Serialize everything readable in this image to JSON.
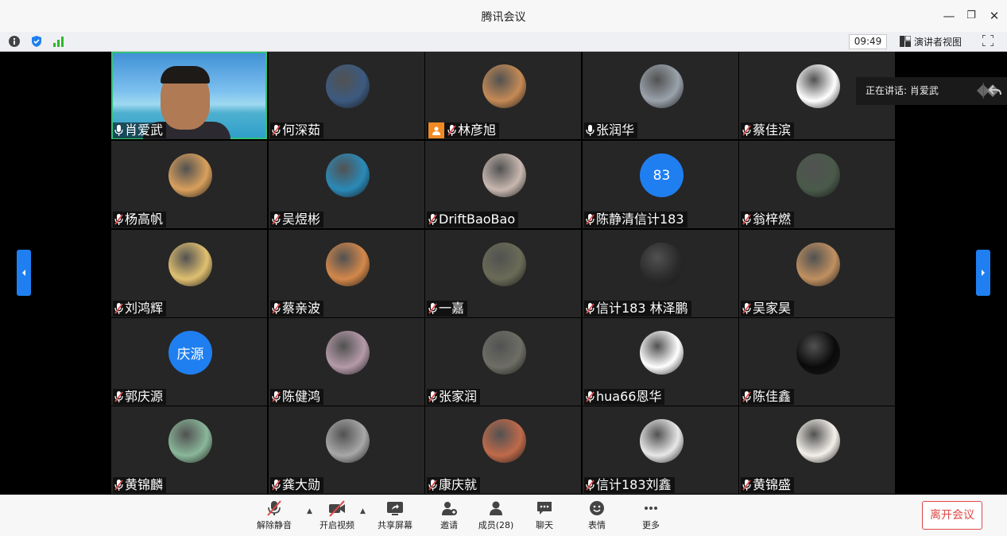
{
  "window": {
    "title": "腾讯会议"
  },
  "infobar": {
    "time": "09:49",
    "speaker_view_label": "演讲者视图"
  },
  "speaking": {
    "label": "正在讲话: 肖爱武"
  },
  "participants": [
    {
      "name": "肖爱武",
      "mic": "on",
      "video": true
    },
    {
      "name": "何深茹",
      "mic": "muted"
    },
    {
      "name": "林彦旭",
      "mic": "muted",
      "host": true
    },
    {
      "name": "张润华",
      "mic": "on"
    },
    {
      "name": "蔡佳滨",
      "mic": "muted"
    },
    {
      "name": "杨高帆",
      "mic": "muted"
    },
    {
      "name": "吴煜彬",
      "mic": "muted"
    },
    {
      "name": "DriftBaoBao",
      "mic": "muted"
    },
    {
      "name": "陈静清信计183",
      "mic": "muted",
      "avatar_text": "83"
    },
    {
      "name": "翁梓燃",
      "mic": "muted"
    },
    {
      "name": "刘鸿辉",
      "mic": "muted"
    },
    {
      "name": "蔡亲波",
      "mic": "muted"
    },
    {
      "name": "一嘉",
      "mic": "muted"
    },
    {
      "name": "信计183 林泽鹏",
      "mic": "muted"
    },
    {
      "name": "吴家昊",
      "mic": "muted"
    },
    {
      "name": "郭庆源",
      "mic": "muted",
      "avatar_text": "庆源"
    },
    {
      "name": "陈健鸿",
      "mic": "muted"
    },
    {
      "name": "张家润",
      "mic": "muted"
    },
    {
      "name": "hua66恩华",
      "mic": "muted"
    },
    {
      "name": "陈佳鑫",
      "mic": "muted"
    },
    {
      "name": "黄锦麟",
      "mic": "muted"
    },
    {
      "name": "龚大勋",
      "mic": "muted"
    },
    {
      "name": "康庆就",
      "mic": "muted"
    },
    {
      "name": "信计183刘鑫",
      "mic": "muted"
    },
    {
      "name": "黄锦盛",
      "mic": "muted"
    }
  ],
  "toolbar": {
    "unmute": "解除静音",
    "start_video": "开启视频",
    "share_screen": "共享屏幕",
    "invite": "邀请",
    "members": "成员(28)",
    "chat": "聊天",
    "reactions": "表情",
    "more": "更多",
    "leave": "离开会议"
  },
  "colors": {
    "accent": "#1f7ff0",
    "leave": "#e04848",
    "tile": "#262626",
    "host": "#f08a24"
  }
}
